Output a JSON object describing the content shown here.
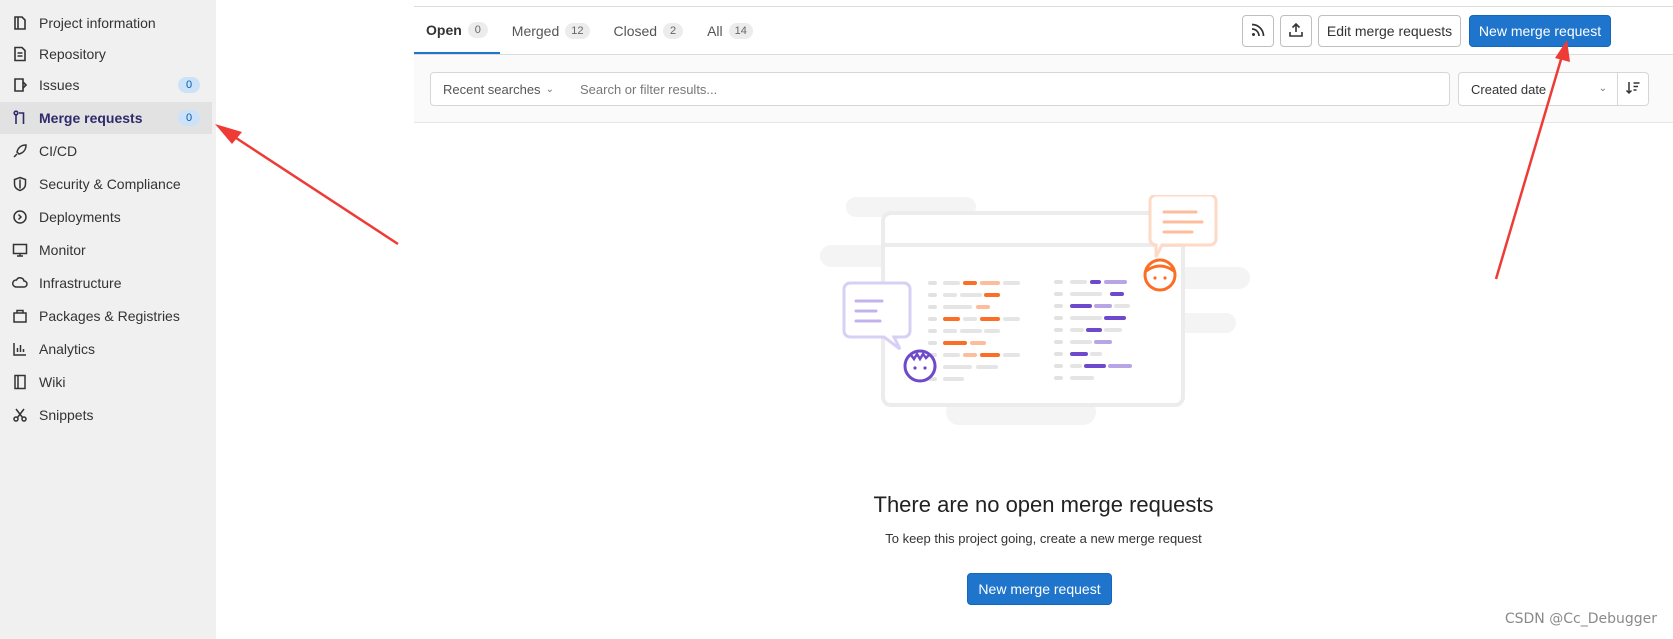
{
  "sidebar": {
    "items": [
      {
        "label": "Project information",
        "icon": "project-information-icon"
      },
      {
        "label": "Repository",
        "icon": "repository-icon"
      },
      {
        "label": "Issues",
        "icon": "issues-icon",
        "badge": "0"
      },
      {
        "label": "Merge requests",
        "icon": "merge-request-icon",
        "badge": "0",
        "active": true
      },
      {
        "label": "CI/CD",
        "icon": "rocket-icon"
      },
      {
        "label": "Security & Compliance",
        "icon": "shield-icon"
      },
      {
        "label": "Deployments",
        "icon": "deployments-icon"
      },
      {
        "label": "Monitor",
        "icon": "monitor-icon"
      },
      {
        "label": "Infrastructure",
        "icon": "cloud-icon"
      },
      {
        "label": "Packages & Registries",
        "icon": "package-icon"
      },
      {
        "label": "Analytics",
        "icon": "chart-icon"
      },
      {
        "label": "Wiki",
        "icon": "book-icon"
      },
      {
        "label": "Snippets",
        "icon": "scissors-icon"
      }
    ]
  },
  "tabs": [
    {
      "label": "Open",
      "count": "0",
      "active": true
    },
    {
      "label": "Merged",
      "count": "12"
    },
    {
      "label": "Closed",
      "count": "2"
    },
    {
      "label": "All",
      "count": "14"
    }
  ],
  "toolbar": {
    "rss_icon": "rss-icon",
    "export_icon": "upload-icon",
    "edit_label": "Edit merge requests",
    "new_label": "New merge request"
  },
  "filter": {
    "recent_label": "Recent searches",
    "search_placeholder": "Search or filter results...",
    "sort_value": "Created date",
    "sort_direction_icon": "sort-lowest-icon"
  },
  "empty_state": {
    "title": "There are no open merge requests",
    "description": "To keep this project going, create a new merge request",
    "button_label": "New merge request"
  },
  "annotations": {
    "arrow_color": "#ee3b36"
  },
  "colors": {
    "primary": "#1f75cb",
    "orange": "#fc6d26",
    "purple": "#6e49cb"
  },
  "watermark": "CSDN @Cc_Debugger"
}
